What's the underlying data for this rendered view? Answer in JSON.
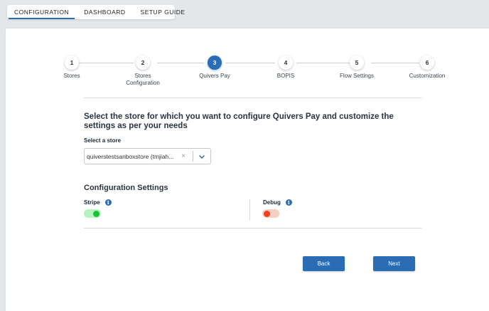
{
  "top_tabs": [
    {
      "label": "CONFIGURATION",
      "active": true
    },
    {
      "label": "DASHBOARD",
      "active": false
    },
    {
      "label": "SETUP GUIDE",
      "active": false
    }
  ],
  "stepper": {
    "current": 3,
    "steps": [
      {
        "number": "1",
        "label": "Stores"
      },
      {
        "number": "2",
        "label": "Stores\nConfiguration"
      },
      {
        "number": "3",
        "label": "Quivers Pay"
      },
      {
        "number": "4",
        "label": "BOPIS"
      },
      {
        "number": "5",
        "label": "Flow Settings"
      },
      {
        "number": "6",
        "label": "Customization"
      }
    ]
  },
  "main": {
    "heading": "Select the store for which you want to configure Quivers Pay and customize the settings as per your needs",
    "store_select": {
      "label": "Select a store",
      "value": "quiverstestsanboxstore (tmjiah...",
      "clear_glyph": "×"
    },
    "config_title": "Configuration Settings",
    "stripe": {
      "label": "Stripe",
      "enabled": true,
      "info_glyph": "i"
    },
    "debug": {
      "label": "Debug",
      "enabled": false,
      "info_glyph": "i"
    }
  },
  "footer": {
    "back_label": "Back",
    "next_label": "Next"
  },
  "colors": {
    "accent": "#2a6db5",
    "toggle_on": "#15c33a",
    "toggle_off": "#f0401c"
  }
}
